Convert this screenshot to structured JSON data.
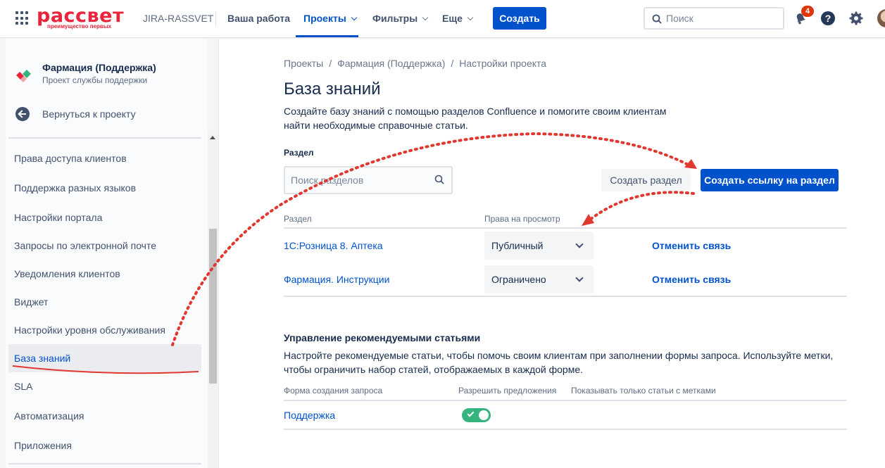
{
  "header": {
    "logo_text": "рассвет",
    "logo_tagline": "преимущество первых",
    "site_name": "JIRA-RASSVET",
    "nav": [
      {
        "label": "Ваша работа"
      },
      {
        "label": "Проекты"
      },
      {
        "label": "Фильтры"
      },
      {
        "label": "Еще"
      }
    ],
    "create_label": "Создать",
    "search_placeholder": "Поиск",
    "notification_count": "4",
    "help_glyph": "?"
  },
  "sidebar": {
    "project_name": "Фармация (Поддержка)",
    "project_type": "Проект службы поддержки",
    "back_label": "Вернуться к проекту",
    "items": [
      {
        "label": "Права доступа клиентов"
      },
      {
        "label": "Поддержка разных языков"
      },
      {
        "label": "Настройки портала"
      },
      {
        "label": "Запросы по электронной почте"
      },
      {
        "label": "Уведомления клиентов"
      },
      {
        "label": "Виджет"
      },
      {
        "label": "Настройки уровня обслуживания"
      },
      {
        "label": "База знаний",
        "active": true
      },
      {
        "label": "SLA"
      },
      {
        "label": "Автоматизация"
      },
      {
        "label": "Приложения"
      }
    ]
  },
  "main": {
    "breadcrumbs": [
      "Проекты",
      "Фармация (Поддержка)",
      "Настройки проекта"
    ],
    "breadcrumb_sep": "/",
    "title": "База знаний",
    "description": "Создайте базу знаний с помощью разделов Confluence и помогите своим клиентам найти необходимые справочные статьи.",
    "section_label": "Раздел",
    "section_search_placeholder": "Поиск разделов",
    "create_section_label": "Создать раздел",
    "link_section_label": "Создать ссылку на раздел",
    "table": {
      "col_section": "Раздел",
      "col_access": "Права на просмотр",
      "rows": [
        {
          "name": "1С:Розница 8. Аптека",
          "access": "Публичный",
          "action": "Отменить связь"
        },
        {
          "name": "Фармация. Инструкции",
          "access": "Ограничено",
          "action": "Отменить связь"
        }
      ]
    },
    "recommended": {
      "title": "Управление рекомендуемыми статьями",
      "description": "Настройте рекомендуемые статьи, чтобы помочь своим клиентам при заполнении формы запроса. Используйте метки, чтобы ограничить набор статей, отображаемых в каждой форме.",
      "col_form": "Форма создания запроса",
      "col_allow": "Разрешить предложения",
      "col_labels": "Показывать только статьи с метками",
      "rows": [
        {
          "form": "Поддержка",
          "allow_suggestions": true
        }
      ]
    }
  },
  "colors": {
    "brand_red": "#e8253a",
    "primary": "#0052cc",
    "annotation_red": "#e0382f",
    "toggle_green": "#36b37e"
  }
}
